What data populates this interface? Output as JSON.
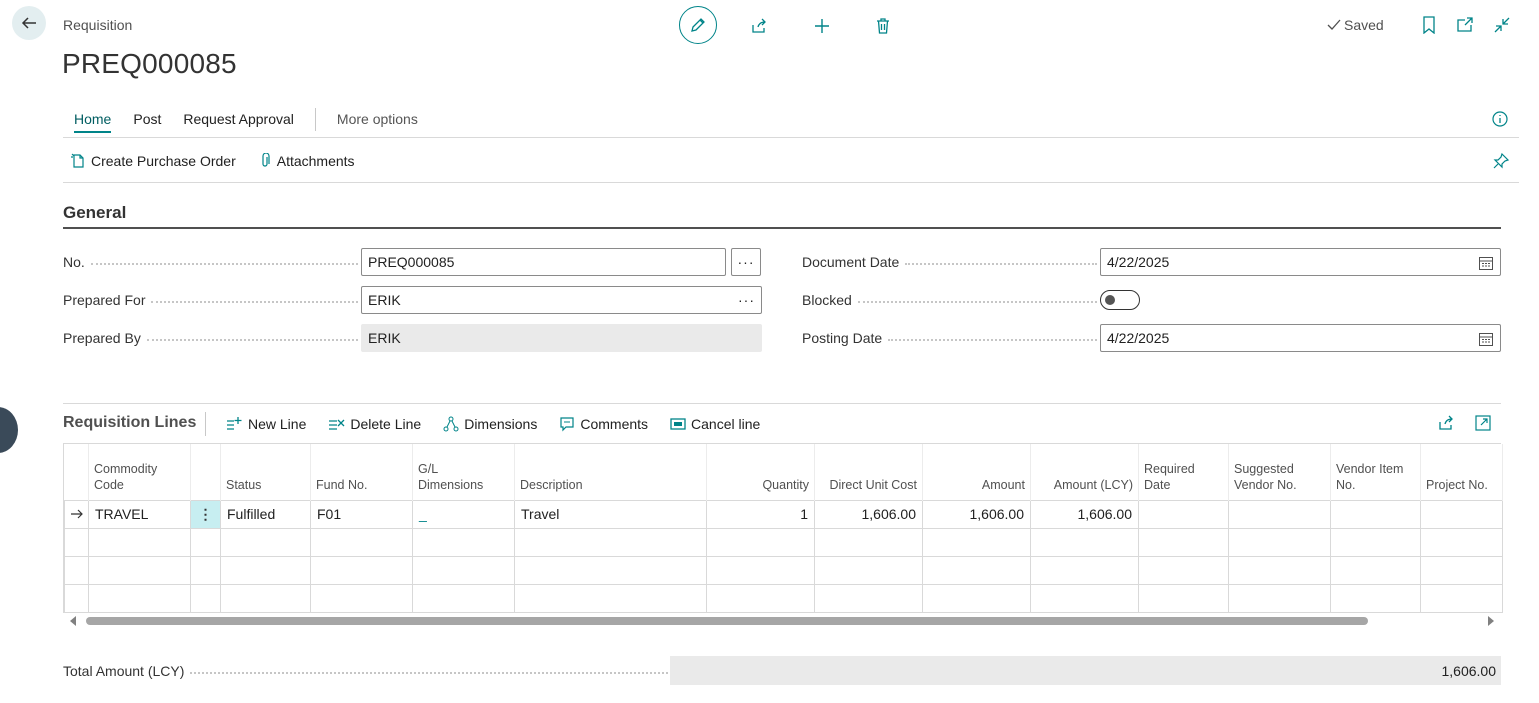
{
  "header": {
    "caption": "Requisition",
    "title": "PREQ000085",
    "saved_label": "Saved"
  },
  "tabs": [
    {
      "label": "Home",
      "active": true
    },
    {
      "label": "Post"
    },
    {
      "label": "Request Approval"
    }
  ],
  "more_options": "More options",
  "command_bar": {
    "create_po": "Create Purchase Order",
    "attachments": "Attachments"
  },
  "general": {
    "section_title": "General",
    "no_label": "No.",
    "no_value": "PREQ000085",
    "prepared_for_label": "Prepared For",
    "prepared_for_value": "ERIK",
    "prepared_by_label": "Prepared By",
    "prepared_by_value": "ERIK",
    "document_date_label": "Document Date",
    "document_date_value": "4/22/2025",
    "blocked_label": "Blocked",
    "blocked_value": false,
    "posting_date_label": "Posting Date",
    "posting_date_value": "4/22/2025"
  },
  "lines": {
    "title": "Requisition Lines",
    "commands": {
      "new_line": "New Line",
      "delete_line": "Delete Line",
      "dimensions": "Dimensions",
      "comments": "Comments",
      "cancel_line": "Cancel line"
    },
    "columns": {
      "commodity_code_1": "Commodity",
      "commodity_code_2": "Code",
      "status": "Status",
      "fund_no": "Fund No.",
      "gl_dimensions_1": "G/L",
      "gl_dimensions_2": "Dimensions",
      "description": "Description",
      "quantity": "Quantity",
      "direct_unit_cost": "Direct Unit Cost",
      "amount": "Amount",
      "amount_lcy": "Amount (LCY)",
      "required_date_1": "Required",
      "required_date_2": "Date",
      "suggested_vendor_1": "Suggested",
      "suggested_vendor_2": "Vendor No.",
      "vendor_item_1": "Vendor Item",
      "vendor_item_2": "No.",
      "project_no": "Project No."
    },
    "row": {
      "commodity_code": "TRAVEL",
      "status": "Fulfilled",
      "fund_no": "F01",
      "gl_dimensions": "_",
      "description": "Travel",
      "quantity": "1",
      "direct_unit_cost": "1,606.00",
      "amount": "1,606.00",
      "amount_lcy": "1,606.00"
    }
  },
  "totals": {
    "label": "Total Amount (LCY)",
    "value": "1,606.00"
  },
  "colors": {
    "accent": "#008489",
    "selected_cell": "#c7eef1"
  }
}
